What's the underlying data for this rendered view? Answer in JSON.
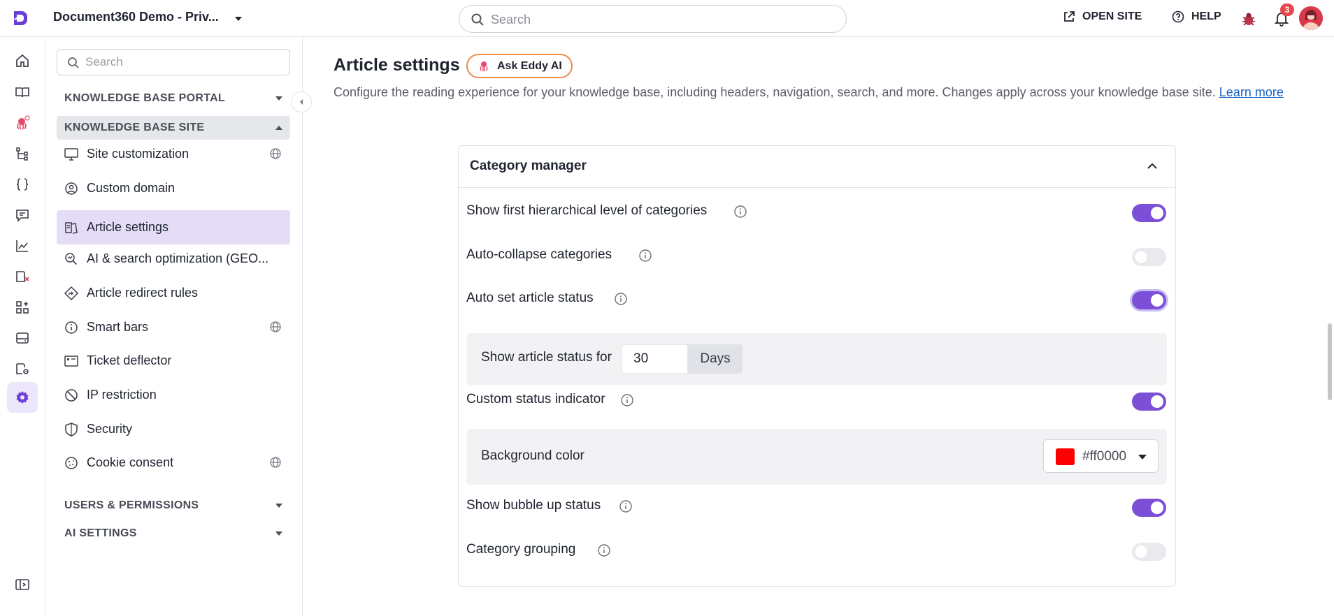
{
  "header": {
    "project_name": "Document360 Demo - Priv...",
    "search_placeholder": "Search",
    "open_site_label": "OPEN SITE",
    "help_label": "HELP",
    "notification_count": "3"
  },
  "rail": {
    "icons": [
      "home-icon",
      "book-icon",
      "eddy-ai-icon",
      "hierarchy-icon",
      "code-braces-icon",
      "chat-icon",
      "analytics-icon",
      "book-x-icon",
      "widgets-icon",
      "drive-icon",
      "book-settings-icon",
      "settings-icon",
      "sidebar-toggle-icon"
    ],
    "active": "settings-icon"
  },
  "nav": {
    "search_placeholder": "Search",
    "sections": [
      {
        "label": "KNOWLEDGE BASE PORTAL",
        "open": false
      },
      {
        "label": "KNOWLEDGE BASE SITE",
        "open": true
      },
      {
        "label": "USERS & PERMISSIONS",
        "open": false
      },
      {
        "label": "AI SETTINGS",
        "open": false
      }
    ],
    "items": [
      {
        "label": "Site customization",
        "icon": "monitor-icon",
        "globe": true
      },
      {
        "label": "Custom domain",
        "icon": "domain-icon",
        "globe": false
      },
      {
        "label": "Article settings",
        "icon": "article-settings-icon",
        "globe": false,
        "active": true
      },
      {
        "label": "AI & search optimization (GEO...",
        "icon": "search-optimization-icon",
        "globe": false
      },
      {
        "label": "Article redirect rules",
        "icon": "redirect-icon",
        "globe": false
      },
      {
        "label": "Smart bars",
        "icon": "info-icon",
        "globe": true
      },
      {
        "label": "Ticket deflector",
        "icon": "ticket-icon",
        "globe": false
      },
      {
        "label": "IP restriction",
        "icon": "block-icon",
        "globe": false
      },
      {
        "label": "Security",
        "icon": "shield-icon",
        "globe": false
      },
      {
        "label": "Cookie consent",
        "icon": "cookie-icon",
        "globe": true
      }
    ]
  },
  "main": {
    "title": "Article settings",
    "ask_eddy_label": "Ask Eddy AI",
    "description": "Configure the reading experience for your knowledge base, including headers, navigation, search, and more. Changes apply across your knowledge base site.",
    "learn_more_label": "Learn more",
    "card": {
      "title": "Category manager",
      "settings": [
        {
          "label": "Show first hierarchical level of categories",
          "enabled": true
        },
        {
          "label": "Auto-collapse categories",
          "enabled": false
        },
        {
          "label": "Auto set article status",
          "enabled": true
        },
        {
          "label": "Custom status indicator",
          "enabled": true
        },
        {
          "label": "Show bubble up status",
          "enabled": true
        },
        {
          "label": "Category grouping",
          "enabled": false
        }
      ],
      "article_status": {
        "label": "Show article status for",
        "value": "30",
        "unit": "Days"
      },
      "background_color": {
        "label": "Background color",
        "hex": "#ff0000"
      }
    }
  },
  "colors": {
    "accent": "#7c50d6",
    "active_nav_bg": "#e5ddf8",
    "eddy_border": "#f08a4b",
    "badge": "#e5484d"
  }
}
